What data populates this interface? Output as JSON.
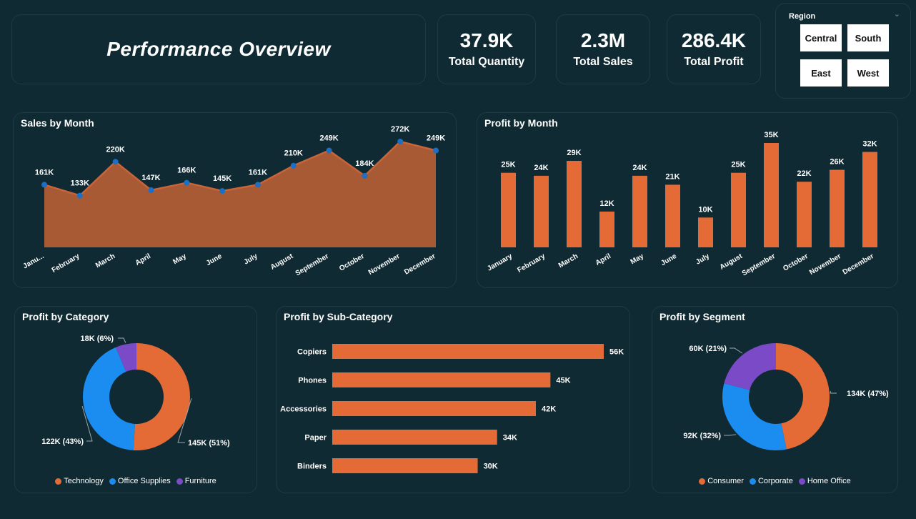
{
  "header": {
    "title": "Performance Overview"
  },
  "kpis": [
    {
      "value": "37.9K",
      "label": "Total Quantity"
    },
    {
      "value": "2.3M",
      "label": "Total Sales"
    },
    {
      "value": "286.4K",
      "label": "Total Profit"
    }
  ],
  "slicer": {
    "title": "Region",
    "options": [
      "Central",
      "South",
      "East",
      "West"
    ]
  },
  "colors": {
    "orange": "#e46b35",
    "area": "#a85a35",
    "blue": "#1b8cf0",
    "purple": "#7b4bc7",
    "point": "#1c6fc4",
    "panel_border": "#1e3a44"
  },
  "chart_data": [
    {
      "id": "sales_by_month",
      "type": "area",
      "title": "Sales by Month",
      "categories": [
        "Janu...",
        "February",
        "March",
        "April",
        "May",
        "June",
        "July",
        "August",
        "September",
        "October",
        "November",
        "December"
      ],
      "values": [
        161,
        133,
        220,
        147,
        166,
        145,
        161,
        210,
        249,
        184,
        272,
        249
      ],
      "labels": [
        "161K",
        "133K",
        "220K",
        "147K",
        "166K",
        "145K",
        "161K",
        "210K",
        "249K",
        "184K",
        "272K",
        "249K"
      ],
      "ylim": [
        0,
        272
      ]
    },
    {
      "id": "profit_by_month",
      "type": "bar",
      "title": "Profit by Month",
      "categories": [
        "January",
        "February",
        "March",
        "April",
        "May",
        "June",
        "July",
        "August",
        "September",
        "October",
        "November",
        "December"
      ],
      "values": [
        25,
        24,
        29,
        12,
        24,
        21,
        10,
        25,
        35,
        22,
        26,
        32
      ],
      "labels": [
        "25K",
        "24K",
        "29K",
        "12K",
        "24K",
        "21K",
        "10K",
        "25K",
        "35K",
        "22K",
        "26K",
        "32K"
      ],
      "ylim": [
        0,
        35
      ]
    },
    {
      "id": "profit_by_category",
      "type": "pie",
      "title": "Profit by Category",
      "categories": [
        "Technology",
        "Office Supplies",
        "Furniture"
      ],
      "values": [
        145,
        122,
        18
      ],
      "labels": [
        "145K (51%)",
        "122K (43%)",
        "18K (6%)"
      ],
      "colors": [
        "#e46b35",
        "#1b8cf0",
        "#7b4bc7"
      ]
    },
    {
      "id": "profit_by_subcategory",
      "type": "bar",
      "title": "Profit by Sub-Category",
      "categories": [
        "Copiers",
        "Phones",
        "Accessories",
        "Paper",
        "Binders"
      ],
      "values": [
        56,
        45,
        42,
        34,
        30
      ],
      "labels": [
        "56K",
        "45K",
        "42K",
        "34K",
        "30K"
      ],
      "ylim": [
        0,
        56
      ]
    },
    {
      "id": "profit_by_segment",
      "type": "pie",
      "title": "Profit by Segment",
      "categories": [
        "Consumer",
        "Corporate",
        "Home Office"
      ],
      "values": [
        134,
        92,
        60
      ],
      "labels": [
        "134K (47%)",
        "92K (32%)",
        "60K (21%)"
      ],
      "colors": [
        "#e46b35",
        "#1b8cf0",
        "#7b4bc7"
      ]
    }
  ]
}
